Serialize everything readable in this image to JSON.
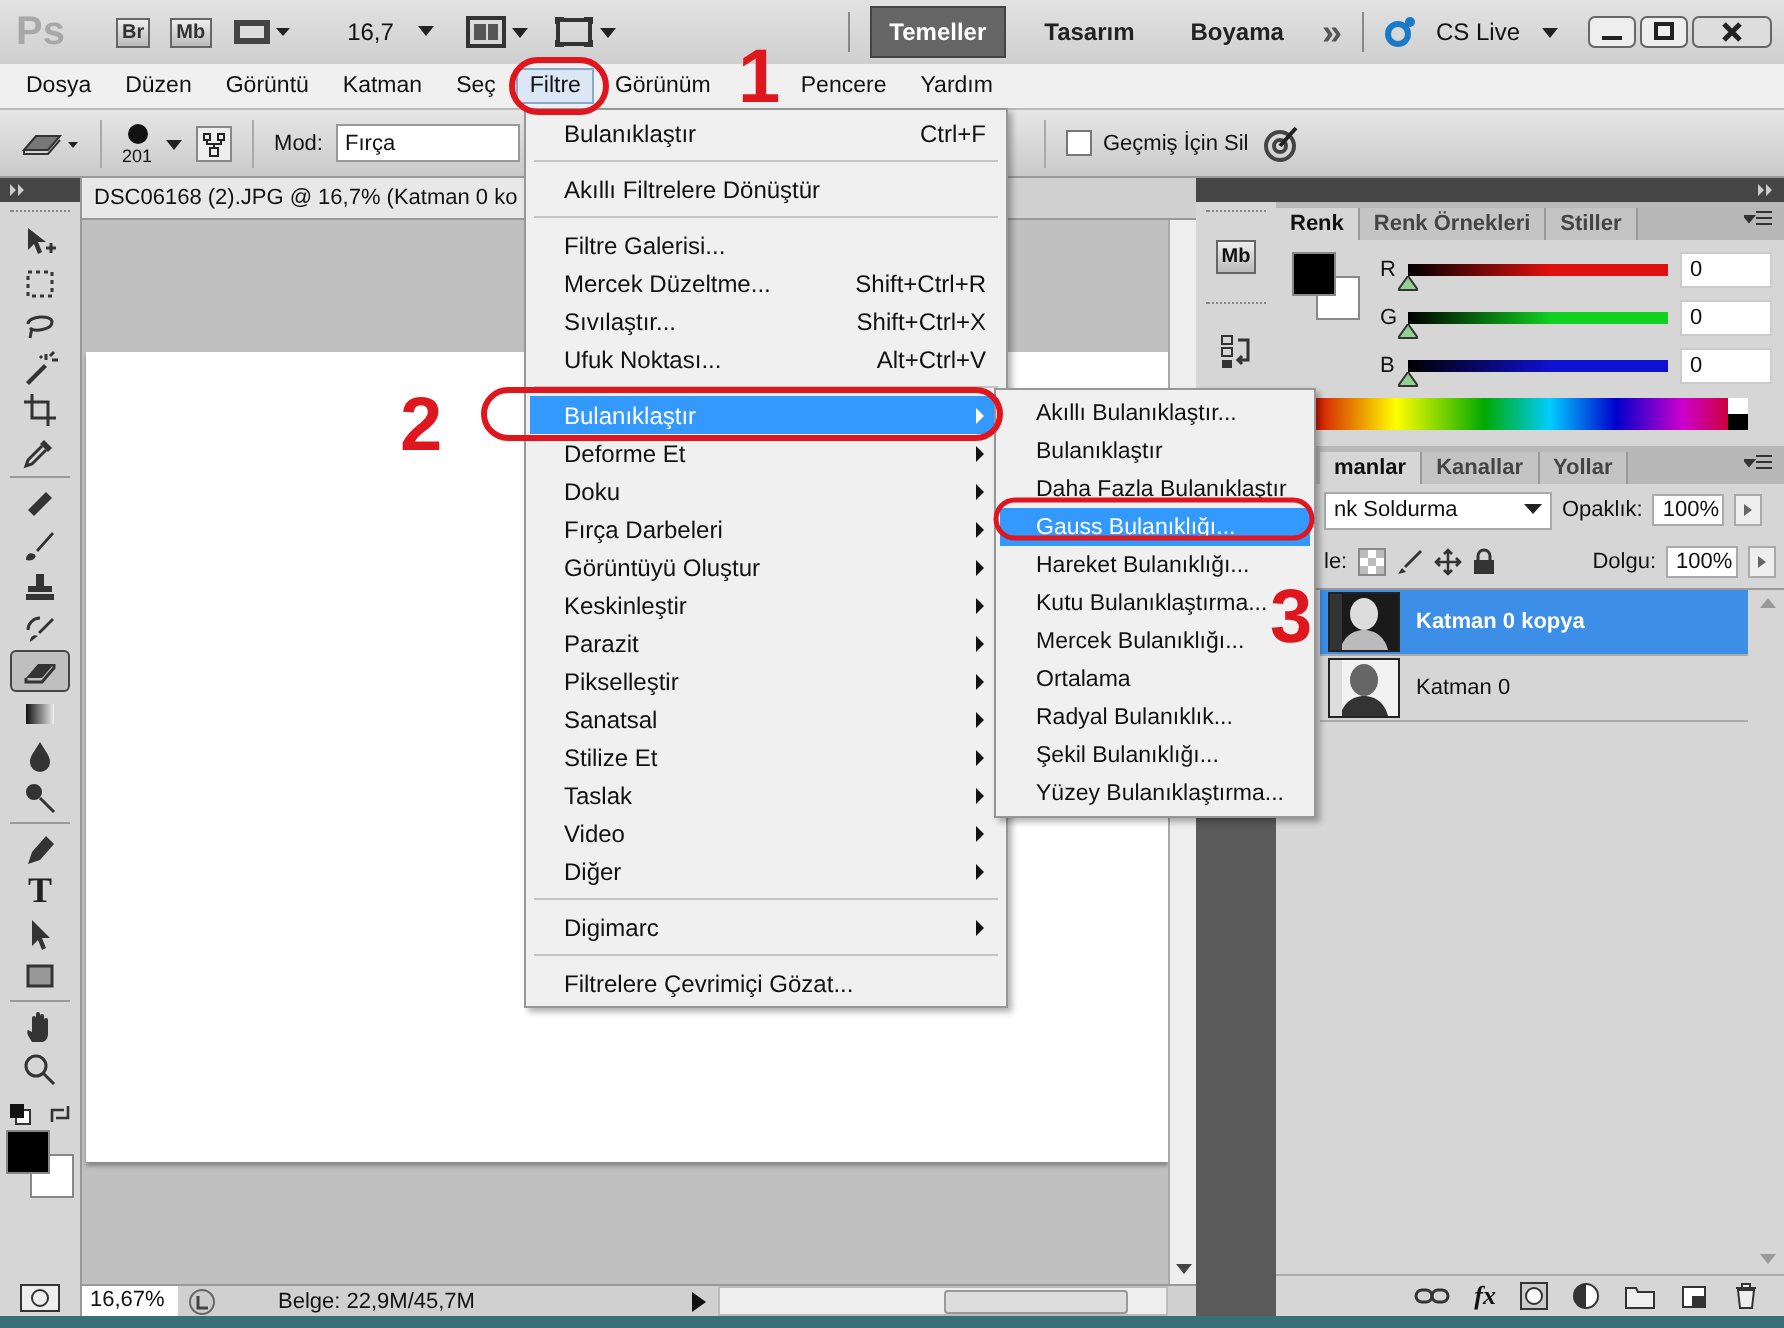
{
  "app_bar": {
    "logo": "Ps",
    "bridge": "Br",
    "mini_bridge": "Mb",
    "zoom": "16,7",
    "workspaces": [
      {
        "label": "Temeller",
        "selected": true
      },
      {
        "label": "Tasarım",
        "selected": false
      },
      {
        "label": "Boyama",
        "selected": false
      }
    ],
    "more": "»",
    "cs_live": "CS Live"
  },
  "menu_bar": [
    {
      "label": "Dosya",
      "selected": false
    },
    {
      "label": "Düzen",
      "selected": false
    },
    {
      "label": "Görüntü",
      "selected": false
    },
    {
      "label": "Katman",
      "selected": false
    },
    {
      "label": "Seç",
      "selected": false
    },
    {
      "label": "Filtre",
      "selected": true
    },
    {
      "label": "Görünüm",
      "selected": false
    },
    {
      "label": "Pencere",
      "selected": false
    },
    {
      "label": "Yardım",
      "selected": false
    }
  ],
  "options_bar": {
    "brush_size": "201",
    "mode_label": "Mod:",
    "mode_value": "Fırça",
    "history_checkbox": {
      "label": "Geçmiş İçin Sil",
      "checked": false
    }
  },
  "tool_groups": [
    [
      {
        "kind": "move",
        "selected": false
      },
      {
        "kind": "marquee",
        "selected": false
      },
      {
        "kind": "lasso",
        "selected": false
      },
      {
        "kind": "wand",
        "selected": false
      },
      {
        "kind": "crop",
        "selected": false
      },
      {
        "kind": "eyedropper",
        "selected": false
      }
    ],
    [
      {
        "kind": "healing",
        "selected": false
      },
      {
        "kind": "brush",
        "selected": false
      },
      {
        "kind": "stamp",
        "selected": false
      },
      {
        "kind": "history",
        "selected": false
      },
      {
        "kind": "eraser",
        "selected": true
      },
      {
        "kind": "gradient",
        "selected": false
      },
      {
        "kind": "blur",
        "selected": false
      },
      {
        "kind": "dodge",
        "selected": false
      }
    ],
    [
      {
        "kind": "pen",
        "selected": false
      },
      {
        "kind": "type",
        "glyph": "T",
        "selected": false
      },
      {
        "kind": "select",
        "selected": false
      },
      {
        "kind": "shape",
        "selected": false
      }
    ],
    [
      {
        "kind": "hand",
        "selected": false
      },
      {
        "kind": "zoom",
        "selected": false
      }
    ]
  ],
  "document": {
    "title": "DSC06168 (2).JPG @ 16,7% (Katman 0 ko"
  },
  "status_bar": {
    "zoom": "16,67%",
    "info": "Belge: 22,9M/45,7M"
  },
  "dock": {
    "mini_bridge": "Mb"
  },
  "color_panel": {
    "tabs": [
      {
        "label": "Renk",
        "selected": true
      },
      {
        "label": "Renk Örnekleri",
        "selected": false
      },
      {
        "label": "Stiller",
        "selected": false
      }
    ],
    "channels": [
      {
        "label": "R",
        "value": "0",
        "level": 0,
        "color": "#e01010"
      },
      {
        "label": "G",
        "value": "0",
        "level": 0,
        "color": "#10d020"
      },
      {
        "label": "B",
        "value": "0",
        "level": 0,
        "color": "#1010d0"
      }
    ]
  },
  "layers_panel": {
    "tabs": [
      {
        "label": "manlar",
        "selected": true
      },
      {
        "label": "Kanallar",
        "selected": false
      },
      {
        "label": "Yollar",
        "selected": false
      }
    ],
    "blend_mode": "nk Soldurma",
    "opacity_label": "Opaklık:",
    "opacity": "100%",
    "lock_label": "le:",
    "fill_label": "Dolgu:",
    "fill": "100%",
    "fx": "fx",
    "layers": [
      {
        "name": "Katman 0 kopya",
        "selected": true
      },
      {
        "name": "Katman 0",
        "selected": false
      }
    ]
  },
  "filter_menu": [
    {
      "kind": "item",
      "label": "Bulanıklaştır",
      "shortcut": "Ctrl+F",
      "selected": false
    },
    {
      "kind": "separator"
    },
    {
      "kind": "item",
      "label": "Akıllı Filtrelere Dönüştür",
      "selected": false
    },
    {
      "kind": "separator"
    },
    {
      "kind": "item",
      "label": "Filtre Galerisi...",
      "selected": false
    },
    {
      "kind": "item",
      "label": "Mercek Düzeltme...",
      "shortcut": "Shift+Ctrl+R",
      "selected": false
    },
    {
      "kind": "item",
      "label": "Sıvılaştır...",
      "shortcut": "Shift+Ctrl+X",
      "selected": false
    },
    {
      "kind": "item",
      "label": "Ufuk Noktası...",
      "shortcut": "Alt+Ctrl+V",
      "selected": false
    },
    {
      "kind": "separator"
    },
    {
      "kind": "submenu",
      "label": "Bulanıklaştır",
      "selected": true
    },
    {
      "kind": "submenu",
      "label": "Deforme Et",
      "selected": false
    },
    {
      "kind": "submenu",
      "label": "Doku",
      "selected": false
    },
    {
      "kind": "submenu",
      "label": "Fırça Darbeleri",
      "selected": false
    },
    {
      "kind": "submenu",
      "label": "Görüntüyü Oluştur",
      "selected": false
    },
    {
      "kind": "submenu",
      "label": "Keskinleştir",
      "selected": false
    },
    {
      "kind": "submenu",
      "label": "Parazit",
      "selected": false
    },
    {
      "kind": "submenu",
      "label": "Pikselleştir",
      "selected": false
    },
    {
      "kind": "submenu",
      "label": "Sanatsal",
      "selected": false
    },
    {
      "kind": "submenu",
      "label": "Stilize Et",
      "selected": false
    },
    {
      "kind": "submenu",
      "label": "Taslak",
      "selected": false
    },
    {
      "kind": "submenu",
      "label": "Video",
      "selected": false
    },
    {
      "kind": "submenu",
      "label": "Diğer",
      "selected": false
    },
    {
      "kind": "separator"
    },
    {
      "kind": "submenu",
      "label": "Digimarc",
      "selected": false
    },
    {
      "kind": "separator"
    },
    {
      "kind": "item",
      "label": "Filtrelere Çevrimiçi Gözat...",
      "selected": false
    }
  ],
  "blur_submenu": [
    {
      "label": "Akıllı Bulanıklaştır...",
      "selected": false
    },
    {
      "label": "Bulanıklaştır",
      "selected": false
    },
    {
      "label": "Daha Fazla Bulanıklaştır",
      "selected": false
    },
    {
      "label": "Gauss Bulanıklığı...",
      "selected": true
    },
    {
      "label": "Hareket Bulanıklığı...",
      "selected": false
    },
    {
      "label": "Kutu Bulanıklaştırma...",
      "selected": false
    },
    {
      "label": "Mercek Bulanıklığı...",
      "selected": false
    },
    {
      "label": "Ortalama",
      "selected": false
    },
    {
      "label": "Radyal Bulanıklık...",
      "selected": false
    },
    {
      "label": "Şekil Bulanıklığı...",
      "selected": false
    },
    {
      "label": "Yüzey Bulanıklaştırma...",
      "selected": false
    }
  ],
  "annotations": [
    {
      "label": "1"
    },
    {
      "label": "2"
    },
    {
      "label": "3"
    }
  ]
}
